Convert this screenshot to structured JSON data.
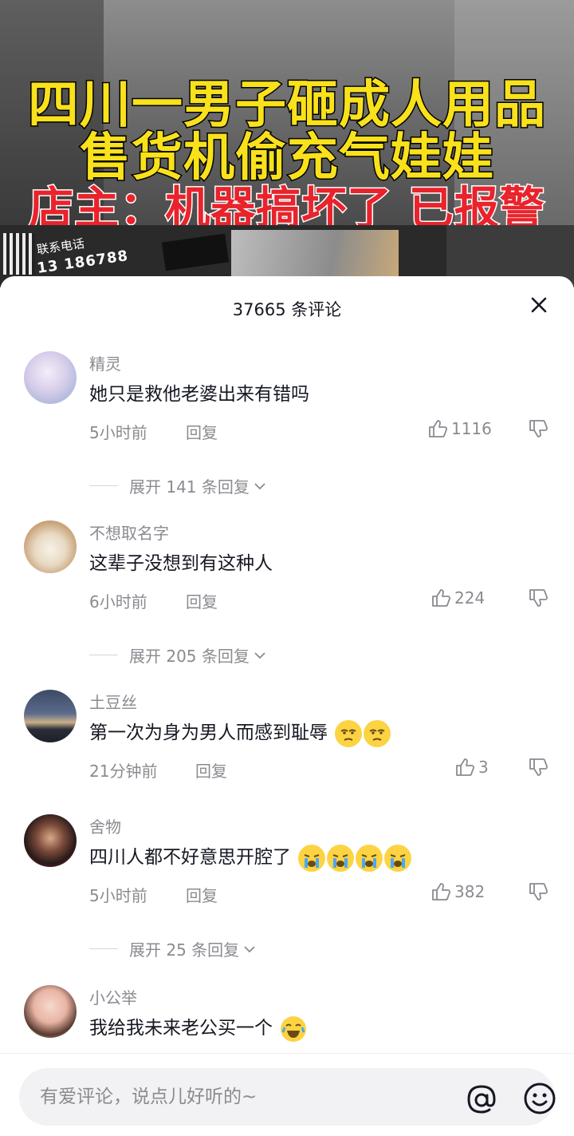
{
  "video": {
    "headline_line1": "四川一男子砸成人用品",
    "headline_line2": "售货机偷充气娃娃",
    "headline_line3": "店主：机器搞坏了 已报警",
    "contact_label": "联系电话",
    "contact_number": "13   186788"
  },
  "sheet": {
    "title": "37665 条评论",
    "close_icon": "close-icon"
  },
  "comments": [
    {
      "username": "精灵",
      "text": "她只是救他老婆出来有错吗",
      "time": "5小时前",
      "reply": "回复",
      "likes": "1116",
      "expand": "展开 141 条回复"
    },
    {
      "username": "不想取名字",
      "text": "这辈子没想到有这种人",
      "time": "6小时前",
      "reply": "回复",
      "likes": "224",
      "expand": "展开 205 条回复"
    },
    {
      "username": "土豆丝",
      "text": "第一次为身为男人而感到耻辱",
      "time": "21分钟前",
      "reply": "回复",
      "likes": "3",
      "emojis": [
        "sweat-emoji",
        "sweat-emoji"
      ]
    },
    {
      "username": "舍物",
      "text": "四川人都不好意思开腔了",
      "time": "5小时前",
      "reply": "回复",
      "likes": "382",
      "expand": "展开 25 条回复",
      "emojis": [
        "crying-emoji",
        "crying-emoji",
        "crying-emoji",
        "crying-emoji"
      ]
    },
    {
      "username": "小公举",
      "text": "我给我未来老公买一个",
      "emojis": [
        "laugh-cry-emoji"
      ]
    }
  ],
  "input": {
    "placeholder": "有爱评论，说点儿好听的~",
    "at_icon": "at-icon",
    "emoji_icon": "emoji-icon"
  },
  "colors": {
    "headline_yellow": "#f9e11b",
    "headline_red": "#e9232c",
    "secondary_text": "#8a8b91",
    "primary_text": "#161823"
  }
}
